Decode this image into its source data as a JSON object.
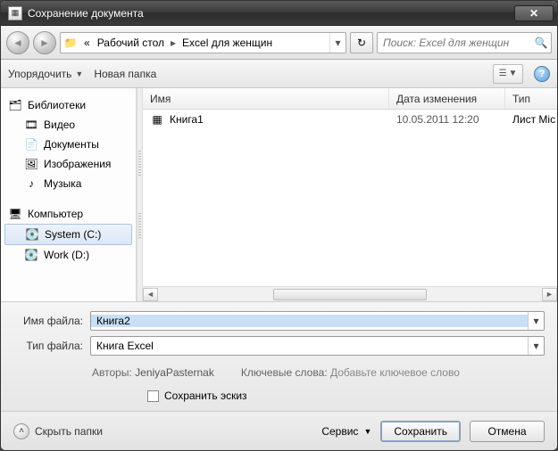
{
  "window": {
    "title": "Сохранение документа",
    "close_x": "✕"
  },
  "nav": {
    "back_arrow": "◄",
    "fwd_arrow": "►",
    "crumb_prefix": "«",
    "crumb1": "Рабочий стол",
    "crumb2": "Excel для женщин",
    "sep": "▸",
    "drop": "▾",
    "refresh": "↻"
  },
  "search": {
    "placeholder": "Поиск: Excel для женщин",
    "icon": "🔍"
  },
  "toolbar": {
    "organize": "Упорядочить",
    "newfolder": "Новая папка",
    "view_icon": "☰",
    "help": "?"
  },
  "sidebar": {
    "libraries": "Библиотеки",
    "video": "Видео",
    "documents": "Документы",
    "images": "Изображения",
    "music": "Музыка",
    "computer": "Компьютер",
    "systemc": "System (C:)",
    "workd": "Work (D:)"
  },
  "columns": {
    "name": "Имя",
    "date": "Дата изменения",
    "type": "Тип"
  },
  "files": [
    {
      "name": "Книга1",
      "date": "10.05.2011 12:20",
      "type": "Лист Mic"
    }
  ],
  "form": {
    "file_label": "Имя файла:",
    "file_value": "Книга2",
    "type_label": "Тип файла:",
    "type_value": "Книга Excel",
    "authors_k": "Авторы:",
    "authors_v": "JeniyaPasternak",
    "keywords_k": "Ключевые слова:",
    "keywords_v": "Добавьте ключевое слово",
    "thumb": "Сохранить эскиз"
  },
  "footer": {
    "hide": "Скрыть папки",
    "service": "Сервис",
    "save": "Сохранить",
    "cancel": "Отмена"
  }
}
